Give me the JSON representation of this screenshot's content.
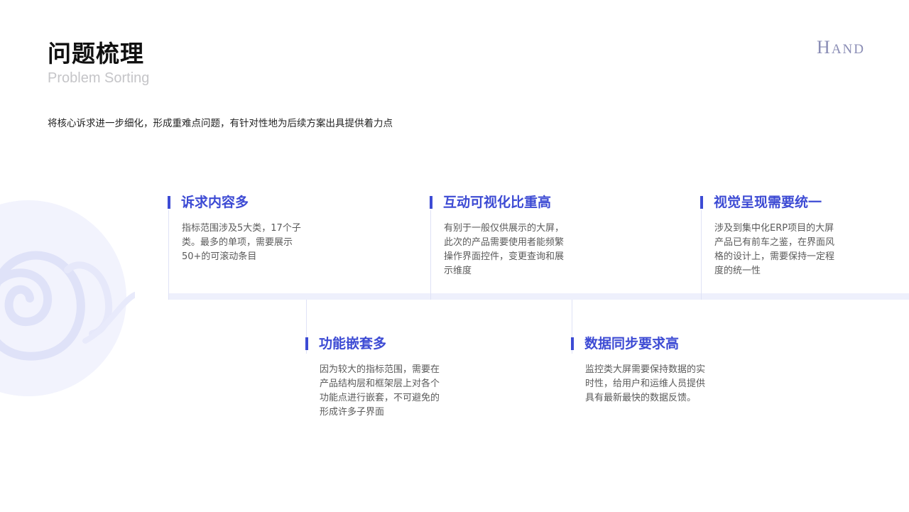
{
  "header": {
    "title": "问题梳理",
    "subtitle": "Problem Sorting",
    "logo_first": "H",
    "logo_rest": "AND"
  },
  "intro": "将核心诉求进一步细化，形成重难点问题，有针对性地为后续方案出具提供着力点",
  "colors": {
    "accent": "#3d4bd4",
    "band": "#eef0fc",
    "logo": "#8a8db5"
  },
  "items": [
    {
      "title": "诉求内容多",
      "desc": "指标范围涉及5大类，17个子类。最多的单项，需要展示50+的可滚动条目"
    },
    {
      "title": "功能嵌套多",
      "desc": "因为较大的指标范围，需要在产品结构层和框架层上对各个功能点进行嵌套，不可避免的形成许多子界面"
    },
    {
      "title": "互动可视化比重高",
      "desc": "有别于一般仅供展示的大屏，此次的产品需要使用者能频繁操作界面控件，变更查询和展示维度"
    },
    {
      "title": "数据同步要求高",
      "desc": "监控类大屏需要保持数据的实时性，给用户和运维人员提供具有最新最快的数据反馈。"
    },
    {
      "title": "视觉呈现需要统一",
      "desc": "涉及到集中化ERP项目的大屏产品已有前车之鉴，在界面风格的设计上，需要保持一定程度的统一性"
    }
  ]
}
